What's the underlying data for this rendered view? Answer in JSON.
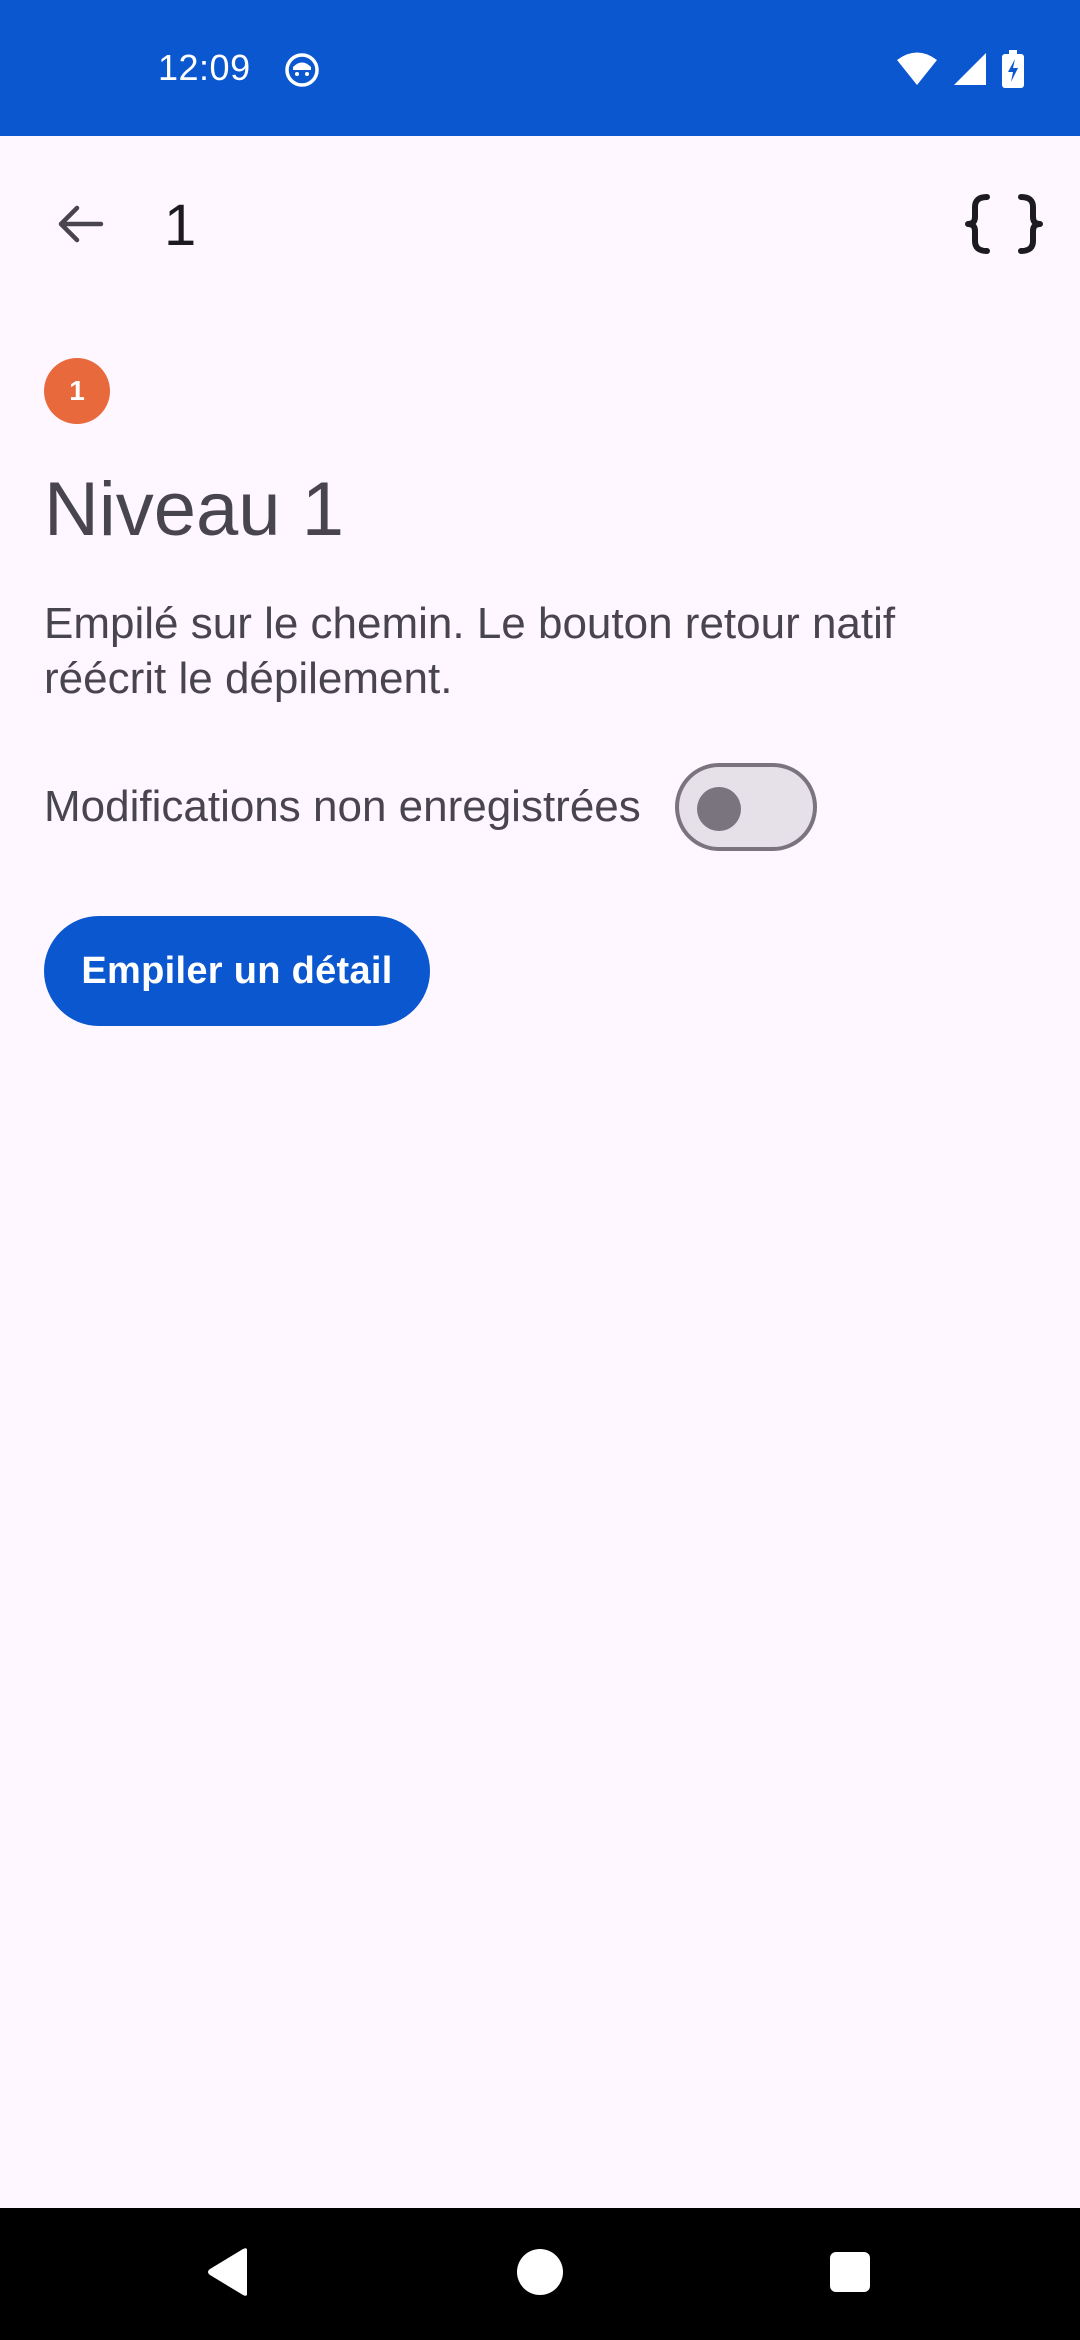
{
  "status_bar": {
    "time": "12:09",
    "icons": [
      "app-notification-icon",
      "wifi-icon",
      "cell-signal-icon",
      "battery-charging-icon"
    ]
  },
  "top_bar": {
    "title": "1",
    "back_icon": "arrow-back-icon",
    "action_icon": "code-braces-icon"
  },
  "content": {
    "badge": "1",
    "title": "Niveau 1",
    "description": "Empilé sur le chemin. Le bouton retour natif réécrit le dépilement.",
    "toggle_label": "Modifications non enregistrées",
    "toggle_on": false,
    "button_label": "Empiler un détail"
  },
  "nav_bar": {
    "icons": [
      "back-triangle-icon",
      "home-circle-icon",
      "recents-square-icon"
    ]
  },
  "colors": {
    "primary": "#0B57D0",
    "background": "#FEF7FF",
    "badge": "#E8693C",
    "text": "#49454F"
  }
}
